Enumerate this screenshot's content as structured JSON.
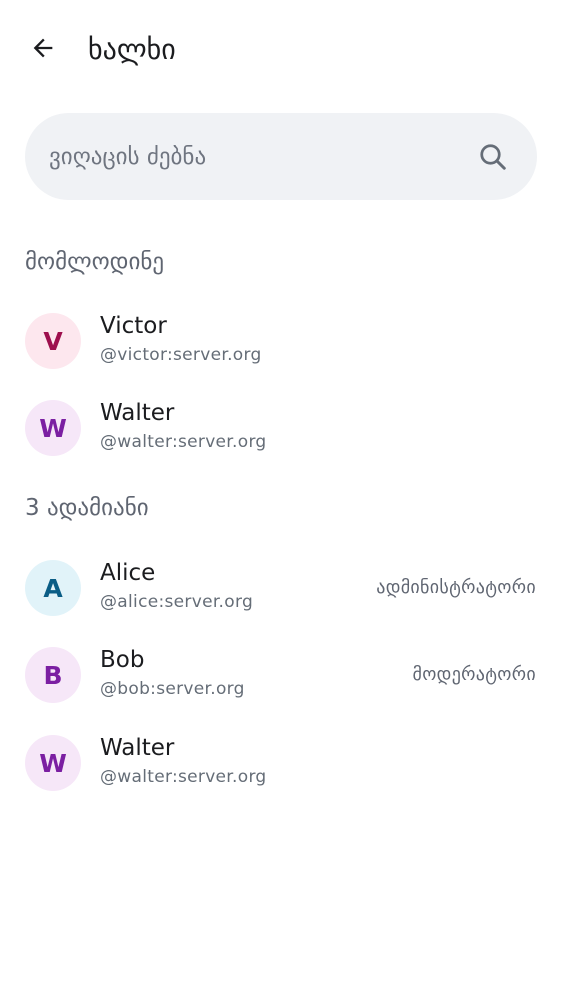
{
  "header": {
    "title": "ხალხი",
    "back_icon": "arrow-left-icon"
  },
  "search": {
    "placeholder": "ვიღაცის ძებნა",
    "value": "",
    "icon": "search-icon"
  },
  "pending_section": {
    "title": "მომლოდინე",
    "members": [
      {
        "initial": "V",
        "name": "Victor",
        "id": "@victor:server.org",
        "avatar_bg": "#fde7ee",
        "avatar_fg": "#9e0f4d"
      },
      {
        "initial": "W",
        "name": "Walter",
        "id": "@walter:server.org",
        "avatar_bg": "#f6e7f8",
        "avatar_fg": "#7b1fa2"
      }
    ]
  },
  "joined_section": {
    "title": "3 ადამიანი",
    "members": [
      {
        "initial": "A",
        "name": "Alice",
        "id": "@alice:server.org",
        "role": "ადმინისტრატორი",
        "avatar_bg": "#e1f3f9",
        "avatar_fg": "#0a5d86"
      },
      {
        "initial": "B",
        "name": "Bob",
        "id": "@bob:server.org",
        "role": "მოდერატორი",
        "avatar_bg": "#f6e7f8",
        "avatar_fg": "#7b1fa2"
      },
      {
        "initial": "W",
        "name": "Walter",
        "id": "@walter:server.org",
        "role": "",
        "avatar_bg": "#f6e7f8",
        "avatar_fg": "#7b1fa2"
      }
    ]
  }
}
